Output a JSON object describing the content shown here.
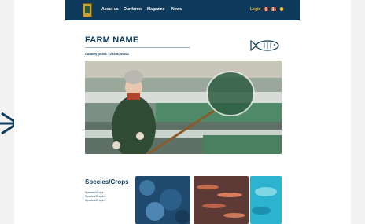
{
  "nav": {
    "items": [
      {
        "label": "About us"
      },
      {
        "label": "Our farms"
      },
      {
        "label": "Magazine"
      },
      {
        "label": "News"
      }
    ],
    "login_label": "Login"
  },
  "farm": {
    "name": "FARM NAME",
    "country_line": "Country (ISSN: 123456789011"
  },
  "species": {
    "title": "Species/Crops",
    "items": [
      "Species/Crops 1",
      "Species/Crops 2",
      "Species/Crops 3"
    ]
  },
  "colors": {
    "brand_navy": "#0e3a5c",
    "login_yellow": "#f1c232",
    "logo_gold": "#c8a33b"
  },
  "icons": [
    "arrow-right-icon",
    "fish-icon",
    "flag-icon"
  ]
}
